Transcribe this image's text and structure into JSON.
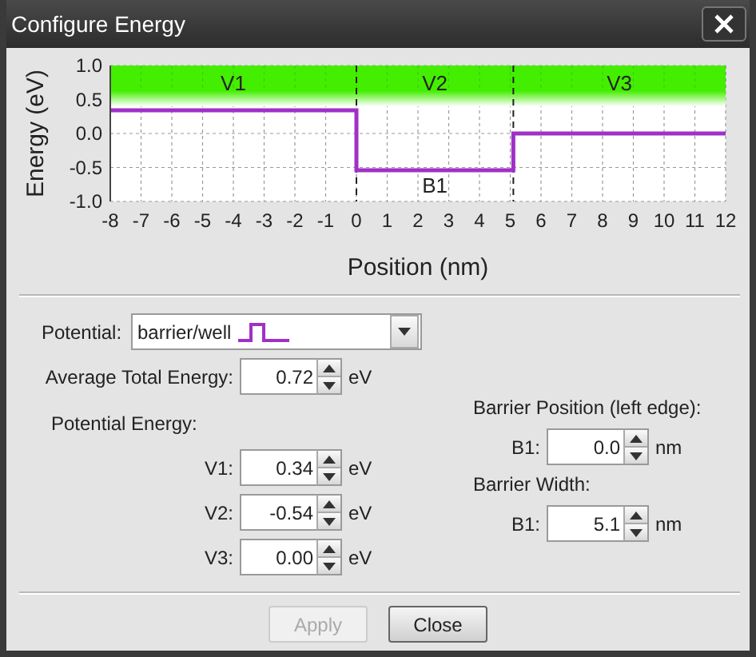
{
  "window": {
    "title": "Configure Energy"
  },
  "chart": {
    "chart_data": {
      "type": "line",
      "xlabel": "Position (nm)",
      "ylabel": "Energy (eV)",
      "xlim": [
        -8,
        12
      ],
      "ylim": [
        -1,
        1
      ],
      "xticks": [
        -8,
        -7,
        -6,
        -5,
        -4,
        -3,
        -2,
        -1,
        0,
        1,
        2,
        3,
        4,
        5,
        6,
        7,
        8,
        9,
        10,
        11,
        12
      ],
      "yticks": [
        {
          "value": 1,
          "label": "1.0"
        },
        {
          "value": 0.5,
          "label": "0.5"
        },
        {
          "value": 0,
          "label": "0.0"
        },
        {
          "value": -0.5,
          "label": "-0.5"
        },
        {
          "value": -1,
          "label": "-1.0"
        }
      ],
      "x": [
        -8,
        0,
        0,
        5.1,
        5.1,
        12
      ],
      "series": [
        {
          "color": "#a030c8",
          "values": [
            0.34,
            0.34,
            -0.54,
            -0.54,
            0,
            0
          ]
        }
      ],
      "annotations": [
        "V1",
        "V2",
        "V3",
        "B1"
      ],
      "grid": true,
      "ref_lines": [
        {
          "axis": "x",
          "value": 0,
          "color": "#222222"
        },
        {
          "axis": "x",
          "value": 5.1,
          "color": "#222222"
        }
      ],
      "bands": [
        {
          "axis": "y",
          "from": 0.4,
          "to": 1,
          "color": "#44ee00"
        }
      ]
    }
  },
  "potential": {
    "label": "Potential:",
    "value": "barrier/well"
  },
  "average_total_energy": {
    "label": "Average Total Energy:",
    "value": "0.72",
    "unit": "eV"
  },
  "potential_energy": {
    "heading": "Potential Energy:",
    "rows": [
      {
        "label": "V1:",
        "value": "0.34",
        "unit": "eV"
      },
      {
        "label": "V2:",
        "value": "-0.54",
        "unit": "eV"
      },
      {
        "label": "V3:",
        "value": "0.00",
        "unit": "eV"
      }
    ]
  },
  "barrier_position": {
    "heading": "Barrier Position (left edge):",
    "label": "B1:",
    "value": "0.0",
    "unit": "nm"
  },
  "barrier_width": {
    "heading": "Barrier Width:",
    "label": "B1:",
    "value": "5.1",
    "unit": "nm"
  },
  "buttons": [
    {
      "label": "Apply",
      "disabled": true
    },
    {
      "label": "Close",
      "disabled": false
    }
  ]
}
